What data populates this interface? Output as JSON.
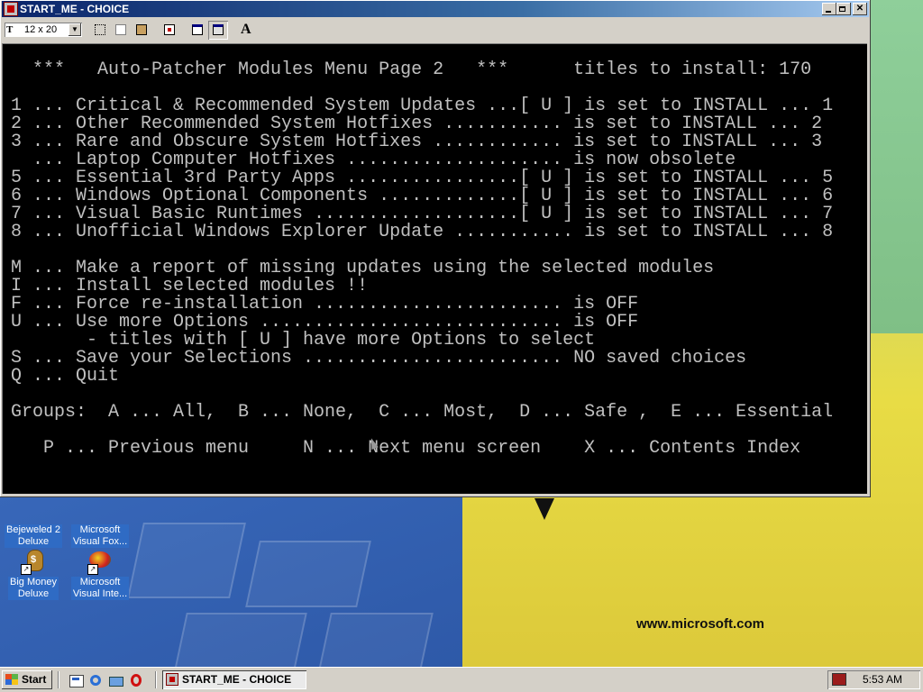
{
  "window": {
    "title": "START_ME - CHOICE",
    "font_size": "12 x 20",
    "font_icon": "T",
    "controls": [
      "minimize-icon",
      "restore-icon",
      "close-icon"
    ]
  },
  "toolbar": {
    "buttons": [
      "mark-icon",
      "copy-icon",
      "paste-icon",
      "fullscreen-icon",
      "properties-icon",
      "background-icon",
      "font-icon"
    ],
    "font_button_label": "A"
  },
  "console": {
    "lines": [
      "  ***   Auto-Patcher Modules Menu Page 2   ***      titles to install: 170",
      "",
      "1 ... Critical & Recommended System Updates ...[ U ] is set to INSTALL ... 1",
      "2 ... Other Recommended System Hotfixes ........... is set to INSTALL ... 2",
      "3 ... Rare and Obscure System Hotfixes ............ is set to INSTALL ... 3",
      "  ... Laptop Computer Hotfixes .................... is now obsolete",
      "5 ... Essential 3rd Party Apps ................[ U ] is set to INSTALL ... 5",
      "6 ... Windows Optional Components .............[ U ] is set to INSTALL ... 6",
      "7 ... Visual Basic Runtimes ...................[ U ] is set to INSTALL ... 7",
      "8 ... Unofficial Windows Explorer Update ........... is set to INSTALL ... 8",
      "",
      "M ... Make a report of missing updates using the selected modules",
      "I ... Install selected modules !!",
      "F ... Force re-installation ....................... is OFF",
      "U ... Use more Options ............................ is OFF",
      "       - titles with [ U ] have more Options to select",
      "S ... Save your Selections ........................ NO saved choices",
      "Q ... Quit",
      "",
      "Groups:  A ... All,  B ... None,  C ... Most,  D ... Safe ,  E ... Essential",
      "",
      "   P ... Previous menu     N ... Next menu screen    X ... Contents Index"
    ]
  },
  "desktop": {
    "icons": [
      {
        "label1": "Bejeweled 2",
        "label2": "Deluxe",
        "icon": "bejeweled-icon"
      },
      {
        "label1": "Microsoft",
        "label2": "Visual Fox...",
        "icon": "visual-foxpro-icon"
      },
      {
        "label1": "Big Money",
        "label2": "Deluxe",
        "icon": "big-money-icon"
      },
      {
        "label1": "Microsoft",
        "label2": "Visual Inte...",
        "icon": "visual-interdev-icon"
      }
    ],
    "wallpaper_text": "www.microsoft.com"
  },
  "taskbar": {
    "start_label": "Start",
    "quick_launch": [
      "show-desktop-icon",
      "internet-explorer-icon",
      "outlook-express-icon",
      "opera-icon"
    ],
    "task_label": "START_ME - CHOICE",
    "clock": "5:53 AM"
  },
  "colors": {
    "console_bg": "#000000",
    "console_fg": "#c0c0c0",
    "title_active": "#0a246a",
    "face": "#d4d0c8"
  }
}
